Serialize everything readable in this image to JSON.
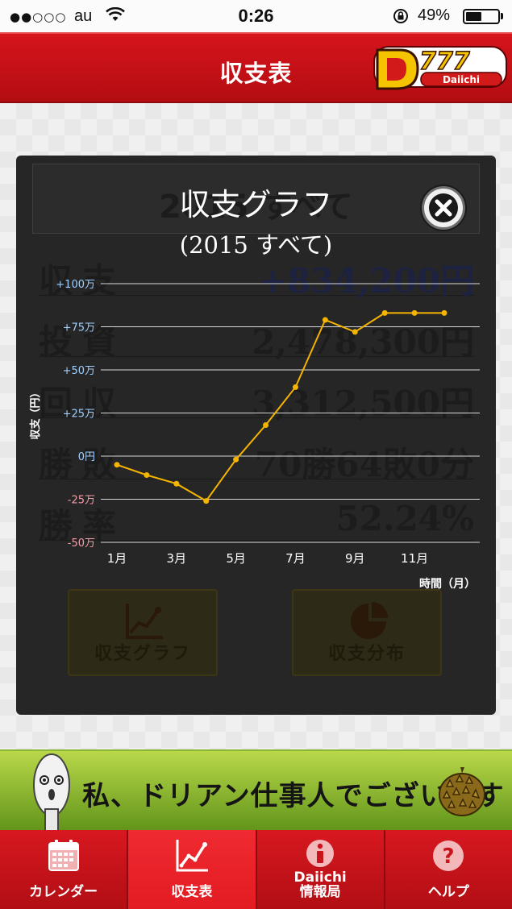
{
  "status_bar": {
    "signal": "●●○○○",
    "carrier": "au",
    "time": "0:26",
    "battery": "49%",
    "battery_level": 0.49
  },
  "header": {
    "title": "収支表",
    "logo_text": "777",
    "logo_sub": "Daiichi"
  },
  "background": {
    "summary_title": "2015 すべて",
    "rows": [
      {
        "label": "収支",
        "value": "+834,200円"
      },
      {
        "label": "投資",
        "value": "2,478,300円"
      },
      {
        "label": "回収",
        "value": "3,312,500円"
      },
      {
        "label": "勝敗",
        "value": "70勝64敗0分"
      },
      {
        "label": "勝率",
        "value": "52.24%"
      }
    ],
    "tiles": [
      {
        "label": "収支グラフ",
        "icon": "line-chart-icon"
      },
      {
        "label": "収支分布",
        "icon": "pie-chart-icon"
      }
    ]
  },
  "modal": {
    "title": "収支グラフ",
    "subtitle": "(2015 すべて)",
    "close_icon": "close-icon"
  },
  "chart_data": {
    "type": "line",
    "ylabel": "収支（円）",
    "xlabel": "時間（月）",
    "y_ticks": [
      {
        "value": 100,
        "label": "+100万"
      },
      {
        "value": 75,
        "label": "+75万"
      },
      {
        "value": 50,
        "label": "+50万"
      },
      {
        "value": 25,
        "label": "+25万"
      },
      {
        "value": 0,
        "label": "0円"
      },
      {
        "value": -25,
        "label": "-25万"
      },
      {
        "value": -50,
        "label": "-50万"
      }
    ],
    "ylim": [
      -50,
      100
    ],
    "xlim": [
      1,
      12
    ],
    "x_ticks": [
      {
        "value": 1,
        "label": "1月"
      },
      {
        "value": 3,
        "label": "3月"
      },
      {
        "value": 5,
        "label": "5月"
      },
      {
        "value": 7,
        "label": "7月"
      },
      {
        "value": 9,
        "label": "9月"
      },
      {
        "value": 11,
        "label": "11月"
      }
    ],
    "series": [
      {
        "color": "#f5b400",
        "points": [
          {
            "x": 1.0,
            "y": -5
          },
          {
            "x": 2.0,
            "y": -11
          },
          {
            "x": 3.0,
            "y": -16
          },
          {
            "x": 4.0,
            "y": -26
          },
          {
            "x": 5.0,
            "y": -2
          },
          {
            "x": 6.0,
            "y": 18
          },
          {
            "x": 7.0,
            "y": 40
          },
          {
            "x": 8.0,
            "y": 79
          },
          {
            "x": 9.0,
            "y": 72
          },
          {
            "x": 10.0,
            "y": 83
          },
          {
            "x": 11.0,
            "y": 83
          },
          {
            "x": 12.0,
            "y": 83
          }
        ]
      }
    ],
    "grid": true,
    "positive_tick_color": "#9fd0ff",
    "negative_tick_color": "#f0a0a8"
  },
  "banner": {
    "text": "私、ドリアン仕事人でございます"
  },
  "tabs": [
    {
      "label": "カレンダー",
      "icon": "calendar-icon",
      "active": false
    },
    {
      "label": "収支表",
      "icon": "chart-icon",
      "active": true
    },
    {
      "label": "Daiichi\n情報局",
      "icon": "info-icon",
      "active": false
    },
    {
      "label": "ヘルプ",
      "icon": "help-icon",
      "active": false
    }
  ]
}
